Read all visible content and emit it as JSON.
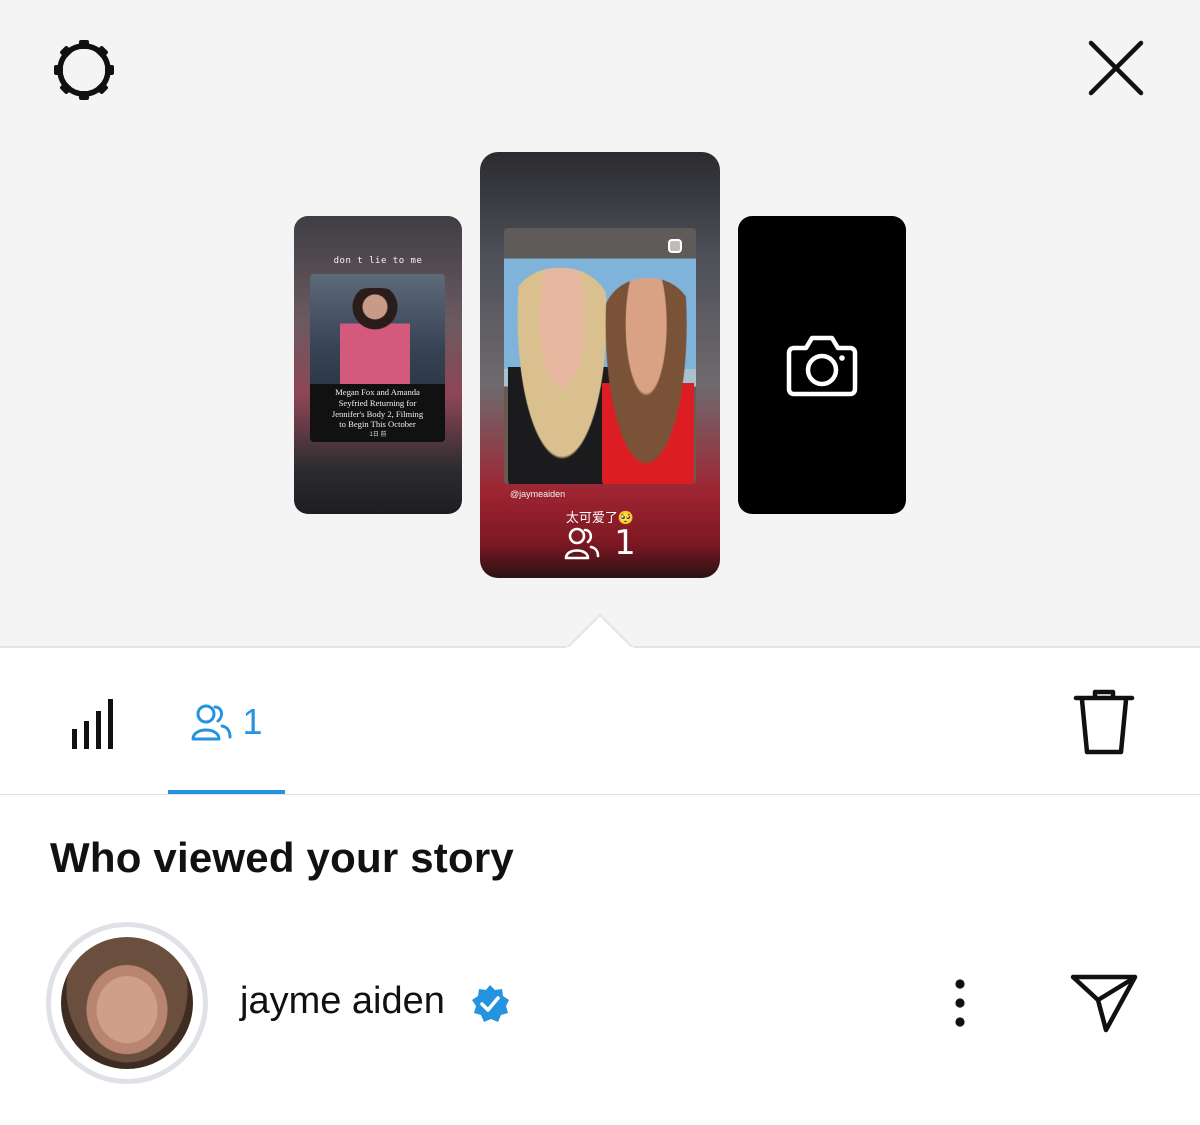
{
  "header": {
    "settings_icon": "gear-icon",
    "close_icon": "close-icon"
  },
  "stories": {
    "left": {
      "caption": "don t lie to me",
      "headline_lines": [
        "Megan Fox and Amanda",
        "Seyfried Returning for",
        "Jennifer's Body 2, Filming",
        "to Begin This October"
      ],
      "time": "1日 前"
    },
    "current": {
      "handle": "@jaymeaiden",
      "caption": "太可爱了🥺",
      "viewer_count": "1",
      "viewers_icon": "people-icon"
    },
    "right": {
      "icon": "camera-icon"
    }
  },
  "tabs": {
    "insights_icon": "bar-chart-icon",
    "viewers_icon": "people-icon",
    "viewers_count": "1",
    "active_color": "#2493e0",
    "delete_icon": "trash-icon"
  },
  "viewers_section": {
    "title": "Who viewed your story",
    "items": [
      {
        "name": "jayme aiden",
        "verified": true,
        "more_icon": "more-vertical-icon",
        "send_icon": "send-icon"
      }
    ]
  }
}
